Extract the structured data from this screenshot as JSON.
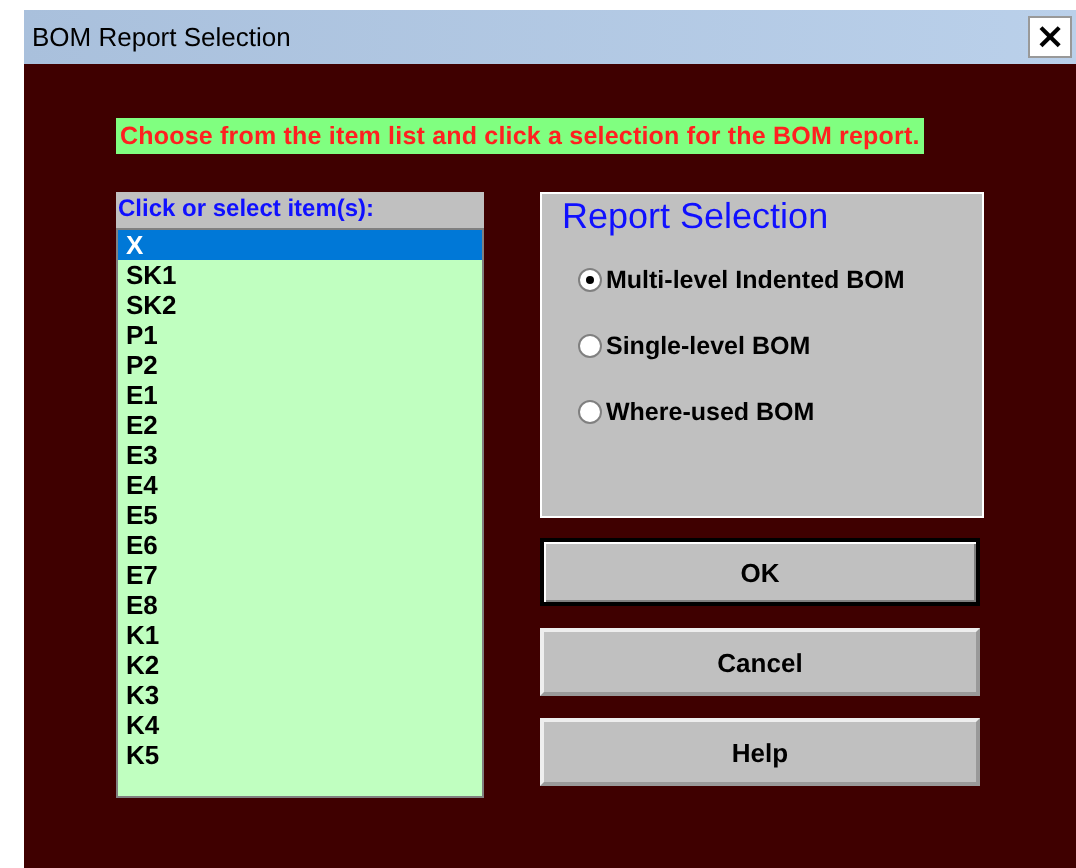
{
  "window": {
    "title": "BOM Report Selection",
    "close": "×"
  },
  "instruction": "Choose from the item list and click a selection for the BOM report.",
  "item_list": {
    "label": "Click or select item(s):",
    "items": [
      {
        "text": "X",
        "selected": true
      },
      {
        "text": "SK1",
        "selected": false
      },
      {
        "text": "SK2",
        "selected": false
      },
      {
        "text": "P1",
        "selected": false
      },
      {
        "text": "P2",
        "selected": false
      },
      {
        "text": "E1",
        "selected": false
      },
      {
        "text": "E2",
        "selected": false
      },
      {
        "text": "E3",
        "selected": false
      },
      {
        "text": "E4",
        "selected": false
      },
      {
        "text": "E5",
        "selected": false
      },
      {
        "text": "E6",
        "selected": false
      },
      {
        "text": "E7",
        "selected": false
      },
      {
        "text": "E8",
        "selected": false
      },
      {
        "text": "K1",
        "selected": false
      },
      {
        "text": "K2",
        "selected": false
      },
      {
        "text": "K3",
        "selected": false
      },
      {
        "text": "K4",
        "selected": false
      },
      {
        "text": "K5",
        "selected": false
      }
    ]
  },
  "report_selection": {
    "title": "Report Selection",
    "options": [
      {
        "label": "Multi-level Indented BOM",
        "selected": true
      },
      {
        "label": "Single-level BOM",
        "selected": false
      },
      {
        "label": "Where-used BOM",
        "selected": false
      }
    ]
  },
  "buttons": [
    {
      "label": "OK",
      "default": true
    },
    {
      "label": "Cancel",
      "default": false
    },
    {
      "label": "Help",
      "default": false
    }
  ]
}
